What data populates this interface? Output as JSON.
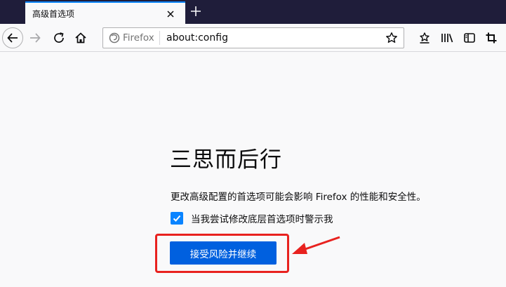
{
  "tab": {
    "title": "高级首选项"
  },
  "urlbar": {
    "identity_label": "Firefox",
    "url": "about:config"
  },
  "page": {
    "heading": "三思而后行",
    "warning": "更改高级配置的首选项可能会影响 Firefox 的性能和安全性。",
    "checkbox_label": "当我尝试修改底层首选项时警示我",
    "checkbox_checked": true,
    "accept_button": "接受风险并继续"
  },
  "colors": {
    "tabstrip": "#1f1d3a",
    "accent": "#0a84ff",
    "button": "#0060df",
    "annotation": "#e8221f"
  }
}
